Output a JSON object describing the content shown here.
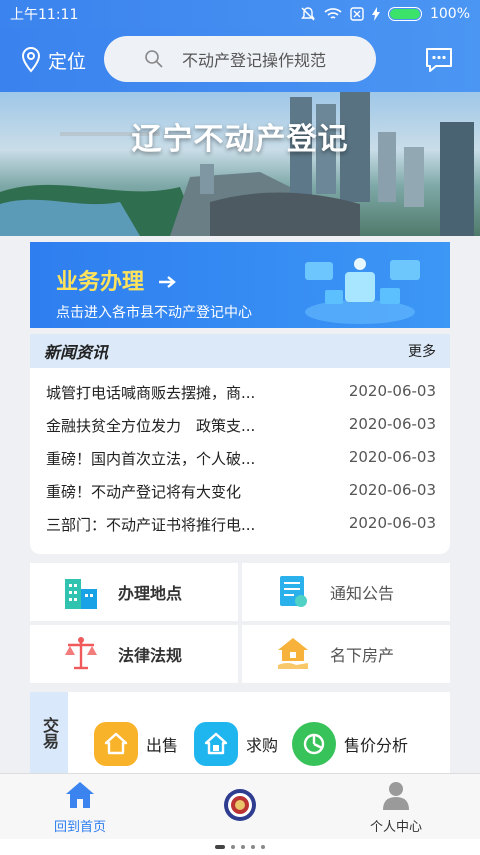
{
  "status": {
    "time": "上午11:11",
    "battery": "100%"
  },
  "header": {
    "location_label": "定位",
    "search_placeholder": "不动产登记操作规范"
  },
  "banner": {
    "title": "辽宁不动产登记"
  },
  "business": {
    "title": "业务办理",
    "subtitle": "点击进入各市县不动产登记中心"
  },
  "news": {
    "title": "新闻资讯",
    "more": "更多",
    "items": [
      {
        "title": "城管打电话喊商贩去摆摊，商...",
        "date": "2020-06-03"
      },
      {
        "title": "金融扶贫全方位发力　政策支...",
        "date": "2020-06-03"
      },
      {
        "title": "重磅！国内首次立法，个人破...",
        "date": "2020-06-03"
      },
      {
        "title": "重磅！不动产登记将有大变化",
        "date": "2020-06-03"
      },
      {
        "title": "三部门：不动产证书将推行电...",
        "date": "2020-06-03"
      }
    ]
  },
  "grid": {
    "locations": "办理地点",
    "notices": "通知公告",
    "laws": "法律法规",
    "properties": "名下房产"
  },
  "trade": {
    "label": "交易",
    "items": [
      {
        "label": "出售",
        "color": "#f9b32b"
      },
      {
        "label": "求购",
        "color": "#1fb6f0"
      },
      {
        "label": "售价分析",
        "color": "#38c25a"
      }
    ]
  },
  "tabbar": {
    "home": "回到首页",
    "profile": "个人中心"
  },
  "colors": {
    "primary": "#3b83ee",
    "accent_yellow": "#ffe35a"
  }
}
